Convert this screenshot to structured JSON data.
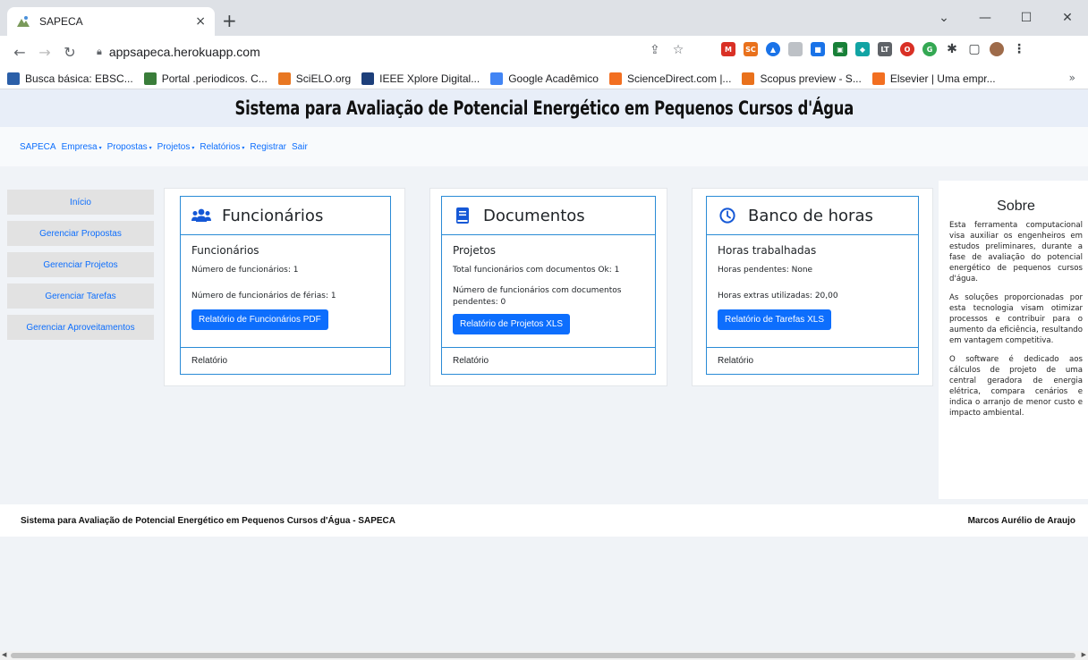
{
  "browser": {
    "tab_title": "SAPECA",
    "tab_close": "×",
    "new_tab": "+",
    "url": "appsapeca.herokuapp.com",
    "window_controls": [
      "⌄",
      "—",
      "☐",
      "✕"
    ],
    "bookmarks": [
      {
        "label": "Busca básica: EBSC...",
        "icon_color": "#2b5fa8",
        "icon": "ebsco-icon"
      },
      {
        "label": "Portal .periodicos. C...",
        "icon_color": "#3a7d3a",
        "icon": "periodicos-icon"
      },
      {
        "label": "SciELO.org",
        "icon_color": "#e87722",
        "icon": "scielo-icon"
      },
      {
        "label": "IEEE Xplore Digital...",
        "icon_color": "#1d3f7a",
        "icon": "ieee-icon"
      },
      {
        "label": "Google Acadêmico",
        "icon_color": "#4285f4",
        "icon": "scholar-icon"
      },
      {
        "label": "ScienceDirect.com |...",
        "icon_color": "#f26f21",
        "icon": "sciencedirect-icon"
      },
      {
        "label": "Scopus preview - S...",
        "icon_color": "#e9711c",
        "icon": "scopus-icon"
      },
      {
        "label": "Elsevier | Uma empr...",
        "icon_color": "#f26f21",
        "icon": "elsevier-icon"
      }
    ],
    "bookmarks_more": "»"
  },
  "header": {
    "title": "Sistema para Avaliação de Potencial Energético em Pequenos Cursos d'Água"
  },
  "nav": {
    "items": [
      {
        "label": "SAPECA",
        "dropdown": false
      },
      {
        "label": "Empresa",
        "dropdown": true
      },
      {
        "label": "Propostas",
        "dropdown": true
      },
      {
        "label": "Projetos",
        "dropdown": true
      },
      {
        "label": "Relatórios",
        "dropdown": true
      },
      {
        "label": "Registrar",
        "dropdown": false
      },
      {
        "label": "Sair",
        "dropdown": false
      }
    ],
    "caret": "▾"
  },
  "sidebar": {
    "items": [
      "Início",
      "Gerenciar Propostas",
      "Gerenciar Projetos",
      "Gerenciar Tarefas",
      "Gerenciar Aproveitamentos"
    ]
  },
  "cards": [
    {
      "icon": "users-icon",
      "title": "Funcionários",
      "subtitle": "Funcionários",
      "lines": [
        "Número de funcionários: 1",
        "Número de funcionários de férias: 1"
      ],
      "button": "Relatório de Funcionários PDF",
      "footer": "Relatório"
    },
    {
      "icon": "book-icon",
      "title": "Documentos",
      "subtitle": "Projetos",
      "lines": [
        "Total funcionários com documentos Ok: 1",
        "Número de funcionários com documentos pendentes: 0"
      ],
      "button": "Relatório de Projetos XLS",
      "footer": "Relatório"
    },
    {
      "icon": "clock-icon",
      "title": "Banco de horas",
      "subtitle": "Horas trabalhadas",
      "lines": [
        "Horas pendentes: None",
        "Horas extras utilizadas: 20,00"
      ],
      "button": "Relatório de Tarefas XLS",
      "footer": "Relatório"
    }
  ],
  "about": {
    "title": "Sobre",
    "paragraphs": [
      "Esta ferramenta computacional visa auxiliar os engenheiros em estudos preliminares, durante a fase de avaliação do potencial energético de pequenos cursos d'água.",
      "As soluções proporcionadas por esta tecnologia visam otimizar processos e contribuir para o aumento da eficiência, resultando em vantagem competitiva.",
      "O software é dedicado aos cálculos de projeto de uma central geradora de energia elétrica, compara cenários e indica o arranjo de menor custo e impacto ambiental."
    ]
  },
  "footer": {
    "left": "Sistema para Avaliação de Potencial Energético em Pequenos Cursos d'Água - SAPECA",
    "right": "Marcos Aurélio de Araujo"
  },
  "colors": {
    "link": "#0d6efd",
    "card_border": "#2a8bd6",
    "header_bg": "#e8eef8",
    "icon_blue": "#1558d6"
  }
}
